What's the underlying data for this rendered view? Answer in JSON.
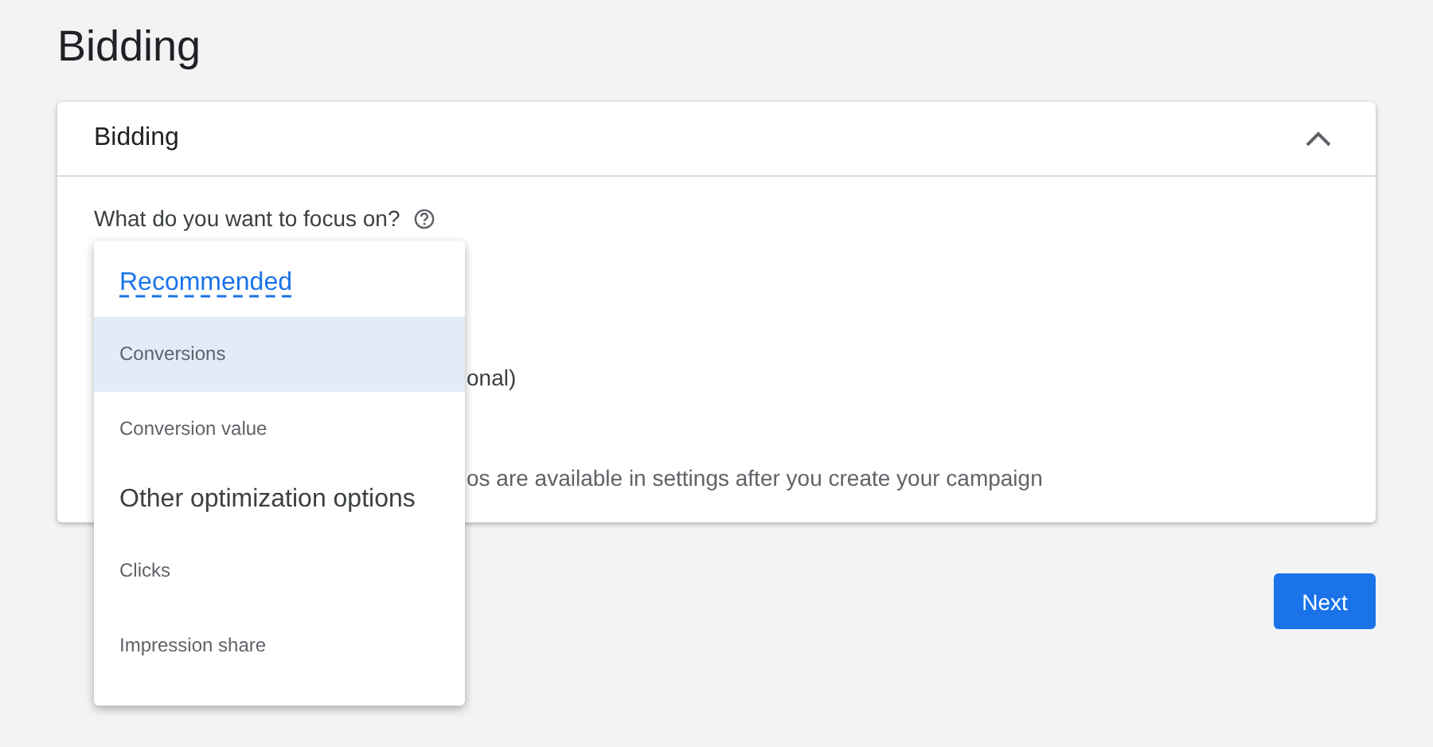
{
  "page_title": "Bidding",
  "card": {
    "title": "Bidding",
    "expanded": true,
    "question": "What do you want to focus on?",
    "covered_texts": [
      "onal)",
      "os are available in settings after you create your campaign"
    ]
  },
  "menu": {
    "groups": [
      {
        "heading": "Recommended",
        "kind": "recommended",
        "items": [
          {
            "label": "Conversions",
            "selected": true
          },
          {
            "label": "Conversion value",
            "selected": false
          }
        ]
      },
      {
        "heading": "Other optimization options",
        "kind": "other",
        "items": [
          {
            "label": "Clicks",
            "selected": false
          },
          {
            "label": "Impression share",
            "selected": false
          }
        ]
      }
    ]
  },
  "next_button": "Next"
}
